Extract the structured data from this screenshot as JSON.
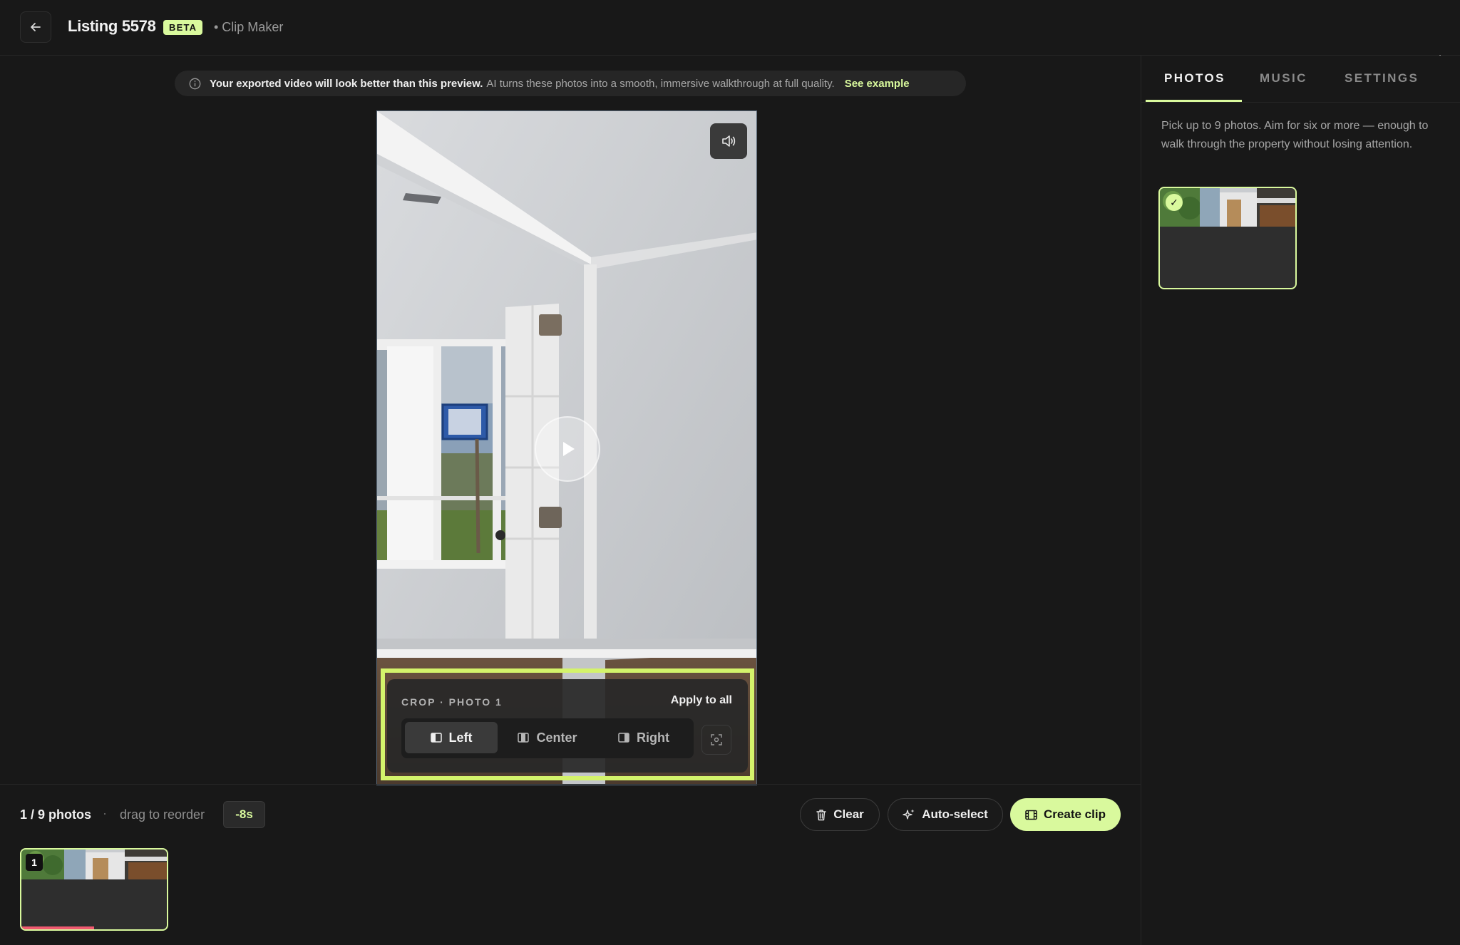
{
  "header": {
    "title": "Listing 5578",
    "badge": "BETA",
    "crumb": "• Clip Maker"
  },
  "banner": {
    "bold": "Your exported video will look better than this preview.",
    "muted": "AI turns these photos into a smooth, immersive walkthrough at full quality.",
    "link": "See example"
  },
  "tabs": [
    {
      "label": "PHOTOS",
      "active": true
    },
    {
      "label": "MUSIC",
      "active": false
    },
    {
      "label": "SETTINGS",
      "active": false
    }
  ],
  "photos_panel": {
    "hint": "Pick up to 9 photos. Aim for six or more — enough to walk through the property without losing attention.",
    "check": "✓"
  },
  "crop": {
    "title": "CROP · PHOTO 1",
    "apply_all": "Apply to all",
    "options": [
      "Left",
      "Center",
      "Right"
    ],
    "selected": "Left"
  },
  "timeline": {
    "count": "1 / 9 photos",
    "sep": "·",
    "drag_hint": "drag to reorder",
    "duration_badge": "-8s",
    "clip_number": "1",
    "clip_progress": 0.5
  },
  "actions": {
    "clear": "Clear",
    "auto_select": "Auto-select",
    "create_clip": "Create clip"
  },
  "colors": {
    "accent": "#d9f99d",
    "highlight": "#d4f36b",
    "progress": "#f05a70",
    "background": "#181818"
  }
}
